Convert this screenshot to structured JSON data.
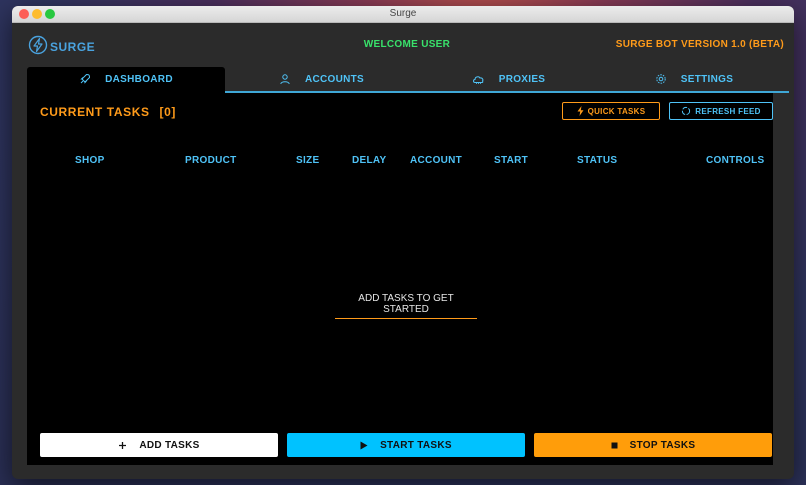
{
  "window": {
    "title": "Surge"
  },
  "header": {
    "logo_text": "SURGE",
    "welcome": "WELCOME USER",
    "version": "SURGE BOT VERSION 1.0 (BETA)"
  },
  "tabs": [
    {
      "label": "DASHBOARD",
      "icon": "rocket-icon",
      "active": true
    },
    {
      "label": "ACCOUNTS",
      "icon": "user-icon",
      "active": false
    },
    {
      "label": "PROXIES",
      "icon": "cloud-icon",
      "active": false
    },
    {
      "label": "SETTINGS",
      "icon": "gear-icon",
      "active": false
    }
  ],
  "dashboard": {
    "title": "CURRENT TASKS",
    "task_count": "[0]",
    "quick_tasks_label": "QUICK TASKS",
    "refresh_feed_label": "REFRESH FEED",
    "columns": [
      "SHOP",
      "PRODUCT",
      "SIZE",
      "DELAY",
      "ACCOUNT",
      "START",
      "STATUS",
      "CONTROLS"
    ],
    "empty_message": "ADD TASKS TO GET STARTED",
    "add_tasks_label": "ADD TASKS",
    "start_tasks_label": "START TASKS",
    "stop_tasks_label": "STOP TASKS"
  },
  "colors": {
    "accent_blue": "#4fc3f7",
    "accent_orange": "#ff9b1a",
    "welcome_green": "#39e26b",
    "start_button": "#00c2ff",
    "stop_button": "#ff9d0a"
  }
}
